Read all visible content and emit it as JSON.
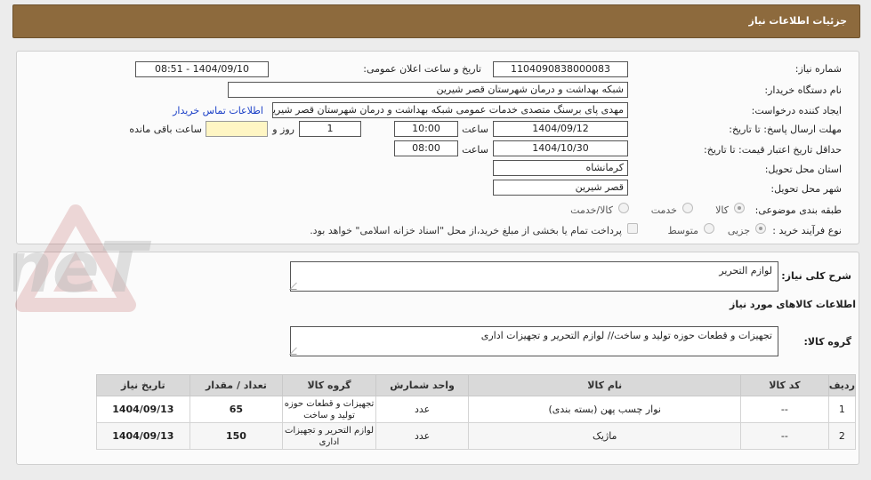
{
  "header": {
    "title": "جزئیات اطلاعات نیاز"
  },
  "form": {
    "need_number_label": "شماره نیاز:",
    "need_number": "1104090838000083",
    "announce_label": "تاریخ و ساعت اعلان عمومی:",
    "announce_value": "1404/09/10 - 08:51",
    "buyer_org_label": "نام دستگاه خریدار:",
    "buyer_org": "شبکه بهداشت و درمان شهرستان قصر شیرین",
    "creator_label": "ایجاد کننده درخواست:",
    "creator": "مهدی پای برسنگ متصدی خدمات عمومی شبکه بهداشت و درمان شهرستان قصر شیرین",
    "contact_link": "اطلاعات تماس خریدار",
    "deadline_label": "مهلت ارسال پاسخ: تا تاریخ:",
    "deadline_date": "1404/09/12",
    "time_label": "ساعت",
    "deadline_time": "10:00",
    "days_value": "1",
    "days_label": "روز و",
    "remaining_value": "",
    "remaining_label": "ساعت باقی مانده",
    "validity_label": "حداقل تاریخ اعتبار قیمت: تا تاریخ:",
    "validity_date": "1404/10/30",
    "validity_time": "08:00",
    "province_label": "استان محل تحویل:",
    "province": "کرمانشاه",
    "city_label": "شهر محل تحویل:",
    "city": "قصر شیرین",
    "category_label": "طبقه بندی موضوعی:",
    "category_options": [
      "کالا",
      "خدمت",
      "کالا/خدمت"
    ],
    "process_label": "نوع فرآیند خرید :",
    "process_options": [
      "جزیی",
      "متوسط"
    ],
    "payment_note": "پرداخت تمام یا بخشی از مبلغ خرید،از محل \"اسناد خزانه اسلامی\" خواهد بود."
  },
  "summary": {
    "label": "شرح کلی نیاز:",
    "value": "لوازم التحریر",
    "goods_info_title": "اطلاعات کالاهای مورد نیاز",
    "group_label": "گروه کالا:",
    "group_value": "تجهیزات و قطعات حوزه تولید و ساخت// لوازم التحریر و تجهیزات اداری"
  },
  "table": {
    "headers": [
      "ردیف",
      "کد کالا",
      "نام کالا",
      "واحد شمارش",
      "گروه کالا",
      "تعداد / مقدار",
      "تاریخ نیاز"
    ],
    "rows": [
      {
        "row": "1",
        "code": "--",
        "name": "نوار چسب پهن (بسته بندی)",
        "unit": "عدد",
        "group": "تجهیزات و قطعات حوزه تولید و ساخت",
        "qty": "65",
        "date": "1404/09/13"
      },
      {
        "row": "2",
        "code": "--",
        "name": "ماژیک",
        "unit": "عدد",
        "group": "لوازم التحریر و تجهیزات اداری",
        "qty": "150",
        "date": "1404/09/13"
      }
    ]
  },
  "watermark": {
    "text": "AriaTender.neT"
  },
  "colors": {
    "header_bg": "#8d6a3d",
    "link": "#1a3fc7",
    "highlight": "#fff6c4"
  }
}
